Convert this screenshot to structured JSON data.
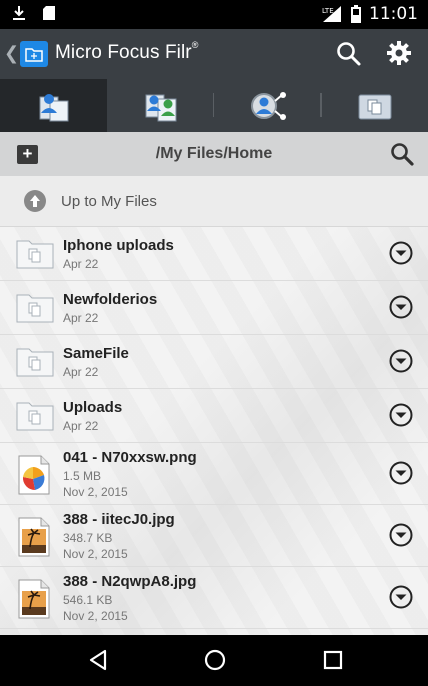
{
  "status_bar": {
    "time": "11:01",
    "network": "LTE"
  },
  "app": {
    "title": "Micro Focus Filr",
    "trademark": "®"
  },
  "tabs": [
    {
      "name": "my-files",
      "active": true
    },
    {
      "name": "shared-with-me",
      "active": false
    },
    {
      "name": "net-folders",
      "active": false
    },
    {
      "name": "shared-by-me",
      "active": false
    }
  ],
  "path": {
    "current": "/My Files/Home"
  },
  "up_row": {
    "label": "Up to My Files"
  },
  "items": [
    {
      "type": "folder",
      "name": "Iphone uploads",
      "date": "Apr 22"
    },
    {
      "type": "folder",
      "name": "Newfolderios",
      "date": "Apr 22"
    },
    {
      "type": "folder",
      "name": "SameFile",
      "date": "Apr 22"
    },
    {
      "type": "folder",
      "name": "Uploads",
      "date": "Apr 22"
    },
    {
      "type": "file",
      "icon": "chart-file-icon",
      "name": "041 - N70xxsw.png",
      "size": "1.5 MB",
      "date": "Nov 2, 2015"
    },
    {
      "type": "file",
      "icon": "image-file-icon",
      "name": "388 - iitecJ0.jpg",
      "size": "348.7 KB",
      "date": "Nov 2, 2015"
    },
    {
      "type": "file",
      "icon": "image-file-icon",
      "name": "388 - N2qwpA8.jpg",
      "size": "546.1 KB",
      "date": "Nov 2, 2015"
    }
  ],
  "colors": {
    "action_bar": "#3a3f44",
    "active_tab": "#24272a",
    "accent": "#1e88e5",
    "path_bar": "#d3d4d5"
  }
}
